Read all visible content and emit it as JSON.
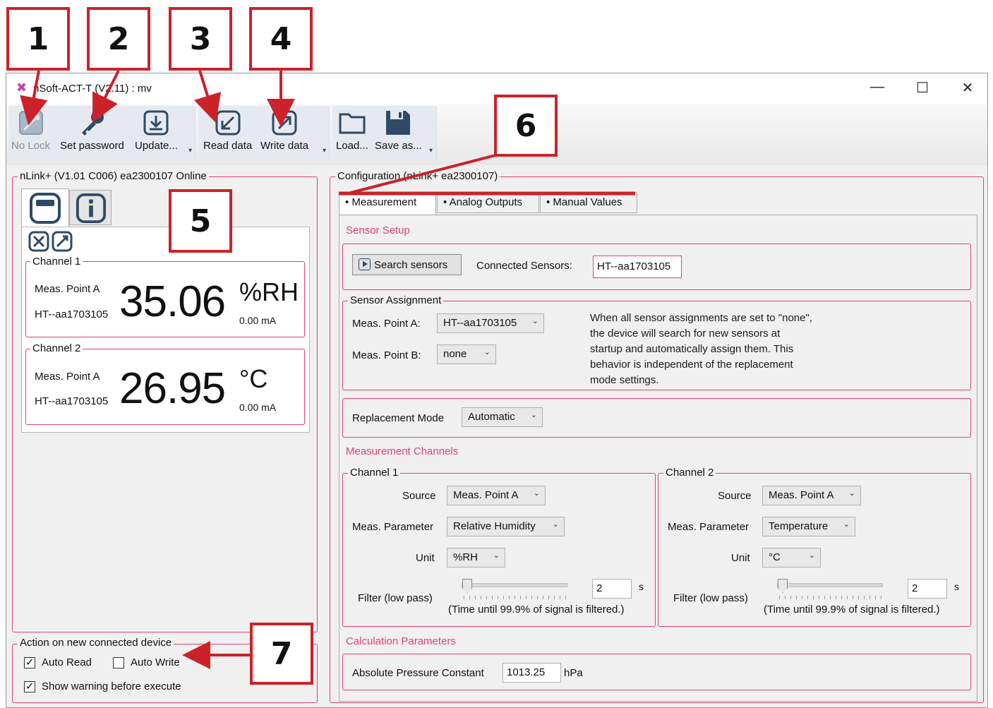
{
  "annotations": [
    "1",
    "2",
    "3",
    "4",
    "5",
    "6",
    "7"
  ],
  "window": {
    "title": "nSoft-ACT-T (V2.11) : mv",
    "minimize": "—",
    "maximize": "☐",
    "close": "✕"
  },
  "toolbar": {
    "no_lock": "No Lock",
    "set_password": "Set password",
    "update": "Update...",
    "read_data": "Read data",
    "write_data": "Write data",
    "load": "Load...",
    "save_as": "Save as..."
  },
  "left_panel": {
    "title": "nLink+ (V1.01 C006) ea2300107 Online",
    "channels": [
      {
        "label": "Channel 1",
        "meas_point": "Meas. Point A",
        "sensor": "HT--aa1703105",
        "value": "35.06",
        "unit": "%RH",
        "current": "0.00  mA"
      },
      {
        "label": "Channel 2",
        "meas_point": "Meas. Point A",
        "sensor": "HT--aa1703105",
        "value": "26.95",
        "unit": "°C",
        "current": "0.00  mA"
      }
    ]
  },
  "action_box": {
    "title": "Action on new connected device",
    "auto_read": "Auto Read",
    "auto_read_checked": true,
    "auto_write": "Auto Write",
    "auto_write_checked": false,
    "show_warning": "Show warning before execute",
    "show_warning_checked": true
  },
  "config": {
    "title": "Configuration (nLink+ ea2300107)",
    "tabs": [
      "• Measurement",
      "• Analog Outputs",
      "• Manual Values"
    ],
    "sensor_setup": {
      "header": "Sensor Setup",
      "search_button": "Search sensors",
      "connected_label": "Connected Sensors:",
      "connected_value": "HT--aa1703105"
    },
    "assignment": {
      "title": "Sensor Assignment",
      "point_a_label": "Meas. Point A:",
      "point_a_value": "HT--aa1703105",
      "point_b_label": "Meas. Point B:",
      "point_b_value": "none",
      "note": [
        "When all sensor assignments are set to \"none\",",
        "the device will search for new sensors at",
        "startup and automatically assign them. This",
        "behavior is independent of the replacement",
        "mode settings."
      ]
    },
    "replacement": {
      "label": "Replacement Mode",
      "value": "Automatic"
    },
    "channels_header": "Measurement Channels",
    "channels": [
      {
        "title": "Channel 1",
        "source_label": "Source",
        "source": "Meas. Point A",
        "param_label": "Meas. Parameter",
        "param": "Relative Humidity",
        "unit_label": "Unit",
        "unit": "%RH",
        "filter_label": "Filter (low pass)",
        "filter_value": "2",
        "filter_unit": "s",
        "filter_note": "(Time until 99.9% of signal is filtered.)"
      },
      {
        "title": "Channel 2",
        "source_label": "Source",
        "source": "Meas. Point A",
        "param_label": "Meas. Parameter",
        "param": "Temperature",
        "unit_label": "Unit",
        "unit": "°C",
        "filter_label": "Filter (low pass)",
        "filter_value": "2",
        "filter_unit": "s",
        "filter_note": "(Time until 99.9% of signal is filtered.)"
      }
    ],
    "calc": {
      "header": "Calculation Parameters",
      "label": "Absolute Pressure Constant",
      "value": "1013.25",
      "unit": "hPa"
    }
  },
  "colors": {
    "accent": "#e0407a",
    "annotation": "#cc2229"
  }
}
